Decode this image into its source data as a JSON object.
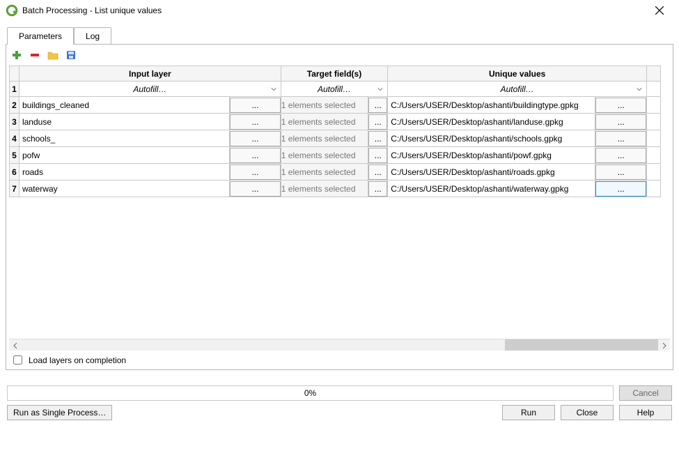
{
  "window": {
    "title": "Batch Processing - List unique values"
  },
  "tabs": {
    "parameters": "Parameters",
    "log": "Log"
  },
  "columns": {
    "input": "Input layer",
    "target": "Target field(s)",
    "unique": "Unique values"
  },
  "autofill_label": "Autofill…",
  "ellipsis": "...",
  "rows": [
    {
      "n": "2",
      "input": "buildings_cleaned",
      "target": "1 elements selected",
      "unique": "C:/Users/USER/Desktop/ashanti/buildingtype.gpkg"
    },
    {
      "n": "3",
      "input": "landuse",
      "target": "1 elements selected",
      "unique": "C:/Users/USER/Desktop/ashanti/landuse.gpkg"
    },
    {
      "n": "4",
      "input": "schools_",
      "target": "1 elements selected",
      "unique": "C:/Users/USER/Desktop/ashanti/schools.gpkg"
    },
    {
      "n": "5",
      "input": "pofw",
      "target": "1 elements selected",
      "unique": "C:/Users/USER/Desktop/ashanti/powf.gpkg"
    },
    {
      "n": "6",
      "input": "roads",
      "target": "1 elements selected",
      "unique": "C:/Users/USER/Desktop/ashanti/roads.gpkg"
    },
    {
      "n": "7",
      "input": "waterway",
      "target": "1 elements selected",
      "unique": "C:/Users/USER/Desktop/ashanti/waterway.gpkg"
    }
  ],
  "first_row_num": "1",
  "load_layers_label": "Load layers on completion",
  "progress_label": "0%",
  "buttons": {
    "cancel": "Cancel",
    "run": "Run",
    "close": "Close",
    "help": "Help",
    "run_single": "Run as Single Process…"
  }
}
